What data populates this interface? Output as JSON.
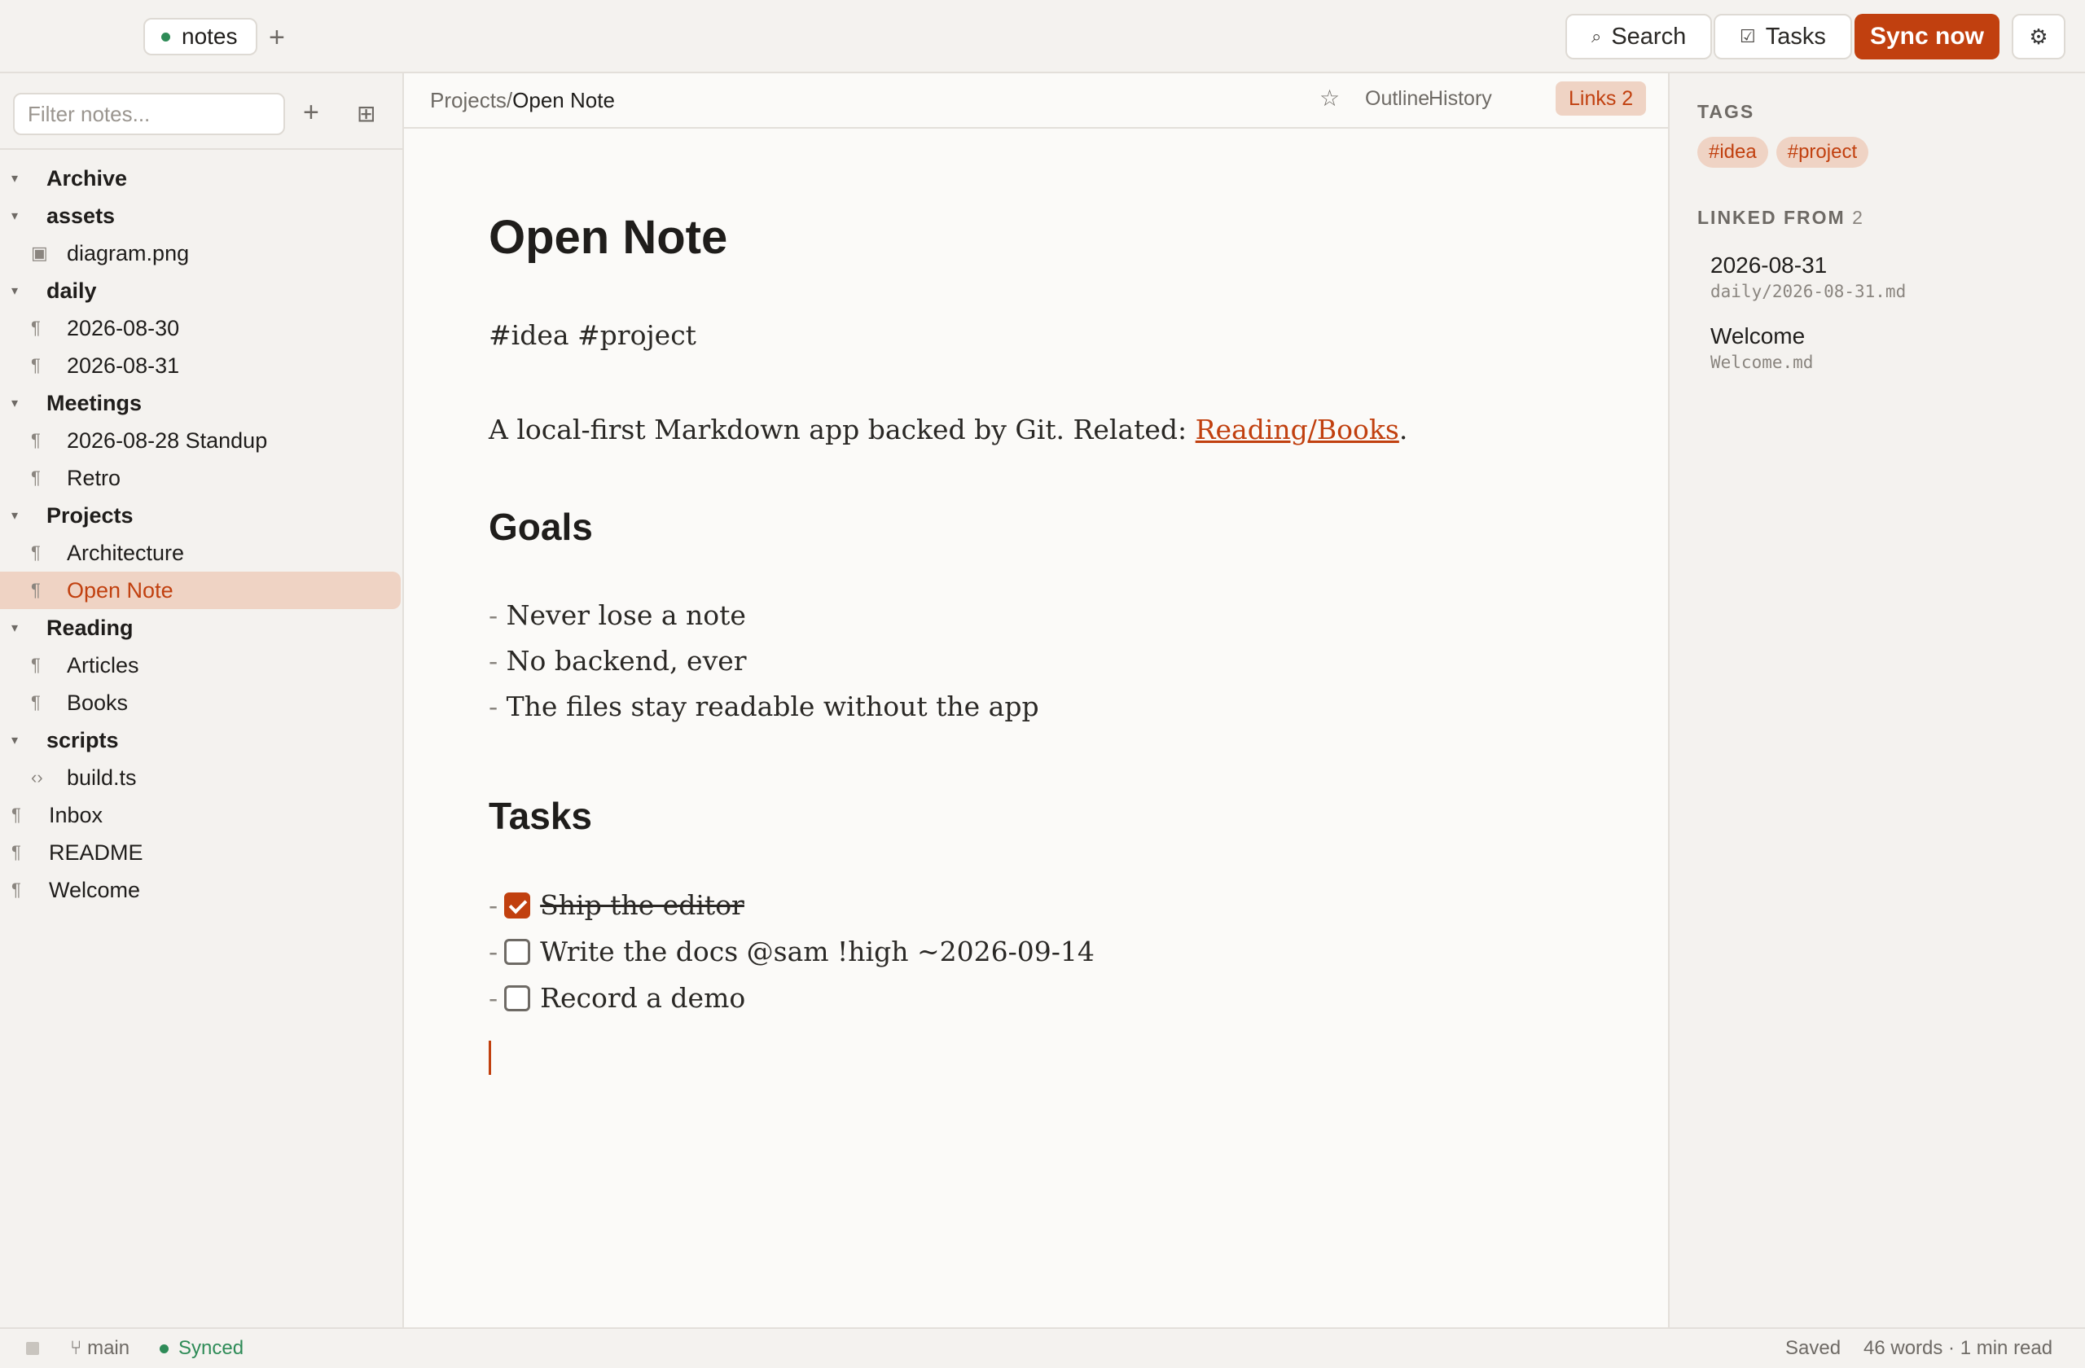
{
  "topbar": {
    "vault_name": "notes",
    "add_vault": "+",
    "search_label": "Search",
    "tasks_label": "Tasks",
    "sync_label": "Sync now",
    "accent_color": "#c1400f"
  },
  "sidebar": {
    "filter_placeholder": "Filter notes...",
    "add_glyph": "+",
    "tree": [
      {
        "label": "Archive",
        "kind": "folder"
      },
      {
        "label": "assets",
        "kind": "folder"
      },
      {
        "label": "diagram.png",
        "kind": "image",
        "depth": 1
      },
      {
        "label": "daily",
        "kind": "folder"
      },
      {
        "label": "2026-08-30",
        "kind": "note",
        "depth": 1
      },
      {
        "label": "2026-08-31",
        "kind": "note",
        "depth": 1
      },
      {
        "label": "Meetings",
        "kind": "folder"
      },
      {
        "label": "2026-08-28 Standup",
        "kind": "note",
        "depth": 1
      },
      {
        "label": "Retro",
        "kind": "note",
        "depth": 1
      },
      {
        "label": "Projects",
        "kind": "folder"
      },
      {
        "label": "Architecture",
        "kind": "note",
        "depth": 1
      },
      {
        "label": "Open Note",
        "kind": "note",
        "depth": 1,
        "active": true
      },
      {
        "label": "Reading",
        "kind": "folder"
      },
      {
        "label": "Articles",
        "kind": "note",
        "depth": 1
      },
      {
        "label": "Books",
        "kind": "note",
        "depth": 1
      },
      {
        "label": "scripts",
        "kind": "folder"
      },
      {
        "label": "build.ts",
        "kind": "code",
        "depth": 1
      },
      {
        "label": "Inbox",
        "kind": "note",
        "depth": 0
      },
      {
        "label": "README",
        "kind": "note",
        "depth": 0
      },
      {
        "label": "Welcome",
        "kind": "note",
        "depth": 0
      }
    ]
  },
  "editor_header": {
    "crumb_path": "Projects/",
    "crumb_current": "Open Note",
    "tabs": {
      "outline": "Outline",
      "history": "History",
      "links": "Links 2"
    }
  },
  "document": {
    "title": "Open Note",
    "tags_line": "#idea #project",
    "intro_text": "A local-first Markdown app backed by Git. Related: ",
    "intro_link": "Reading/Books",
    "intro_end": ".",
    "goals_heading": "Goals",
    "goals": [
      "Never lose a note",
      "No backend, ever",
      "The files stay readable without the app"
    ],
    "tasks_heading": "Tasks",
    "tasks": [
      {
        "text": "Ship the editor",
        "done": true
      },
      {
        "text": "Write the docs @sam !high ~2026-09-14",
        "done": false
      },
      {
        "text": "Record a demo",
        "done": false
      }
    ],
    "dash": "-"
  },
  "right_panel": {
    "tags_title": "TAGS",
    "tags": [
      "#idea",
      "#project"
    ],
    "linked_title": "LINKED FROM",
    "linked_count": "2",
    "backlinks": [
      {
        "title": "2026-08-31",
        "path": "daily/2026-08-31.md"
      },
      {
        "title": "Welcome",
        "path": "Welcome.md"
      }
    ]
  },
  "statusbar": {
    "branch": "main",
    "sync_state": "Synced",
    "saved": "Saved",
    "stats": "46 words · 1 min read"
  }
}
